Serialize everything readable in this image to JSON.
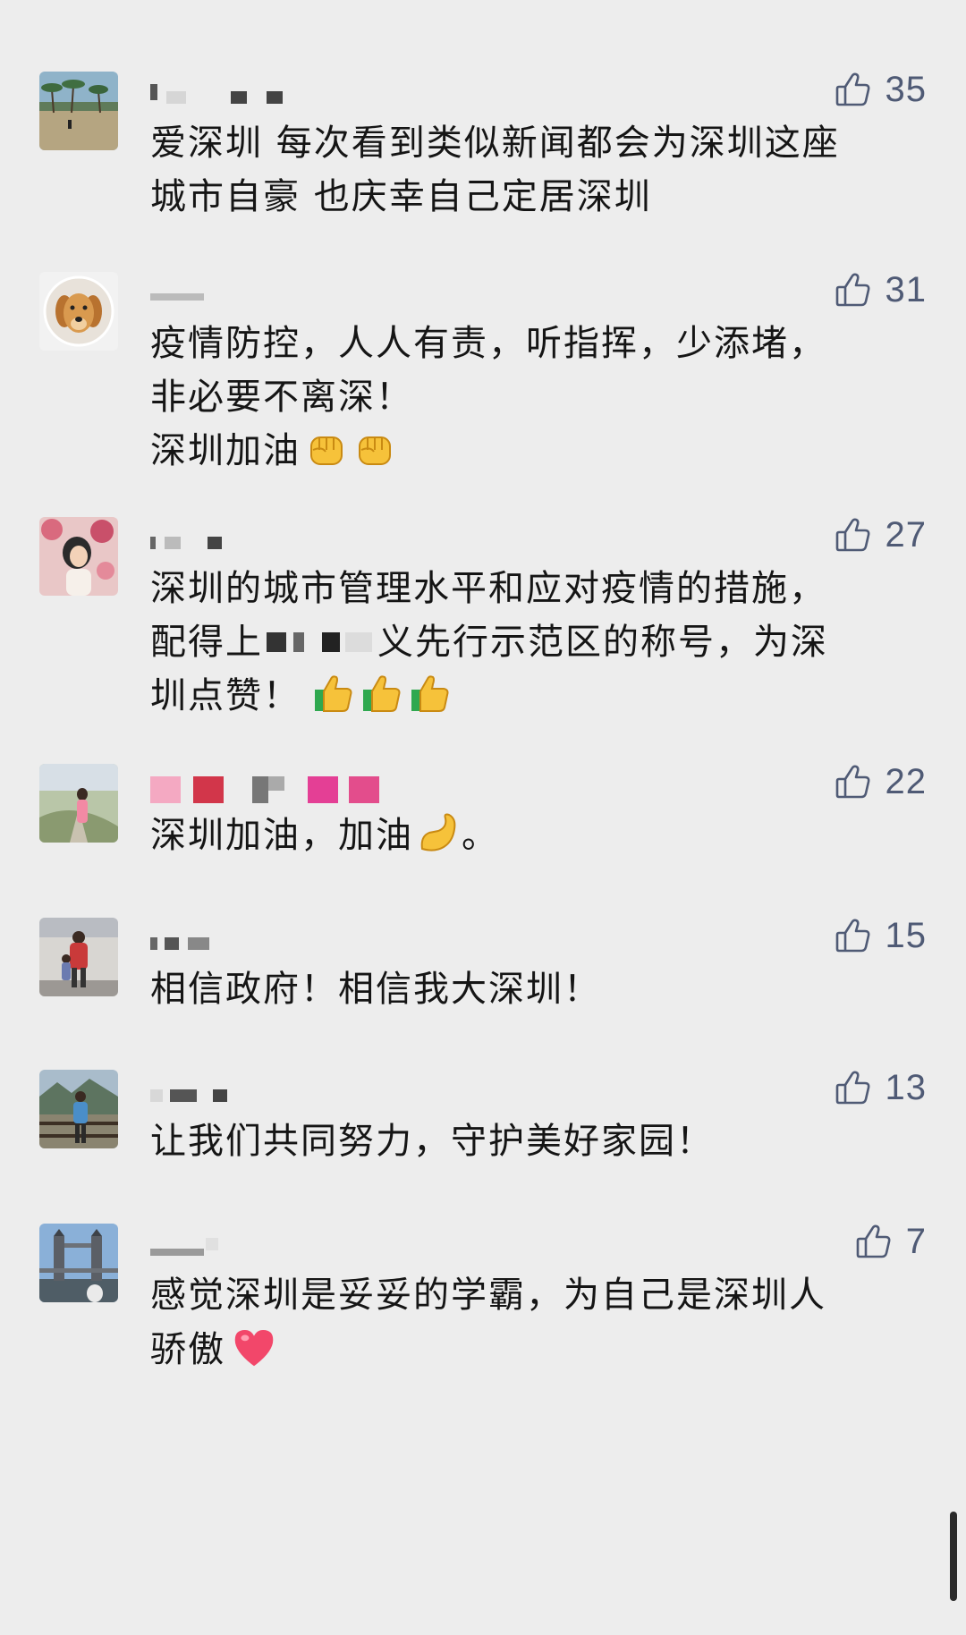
{
  "colors": {
    "background": "#ededed",
    "text": "#151515",
    "like_count": "#4f5a75"
  },
  "comments": [
    {
      "likes": "35",
      "lines": [
        "爱深圳  每次看到类似新闻都会为深圳这座",
        "城市自豪 也庆幸自己定居深圳"
      ],
      "avatar_icon": "beach-photo-avatar",
      "like_icon": "thumbs-up-icon"
    },
    {
      "likes": "31",
      "lines": [
        "疫情防控，人人有责，听指挥，少添堵，",
        "非必要不离深！",
        "深圳加油"
      ],
      "emoji": [
        "raised-fist-emoji",
        "raised-fist-emoji"
      ],
      "avatar_icon": "golden-retriever-avatar",
      "like_icon": "thumbs-up-icon"
    },
    {
      "likes": "27",
      "lines": [
        "深圳的城市管理水平和应对疫情的措施，",
        "配得上",
        "义先行示范区的称号，为深",
        "圳点赞！"
      ],
      "emoji": [
        "thumbs-up-emoji",
        "thumbs-up-emoji",
        "thumbs-up-emoji"
      ],
      "avatar_icon": "girl-flowers-avatar",
      "like_icon": "thumbs-up-icon"
    },
    {
      "likes": "22",
      "lines": [
        "深圳加油，加油",
        "。"
      ],
      "emoji": [
        "flexed-biceps-emoji"
      ],
      "avatar_icon": "woman-path-avatar",
      "like_icon": "thumbs-up-icon"
    },
    {
      "likes": "15",
      "lines": [
        "相信政府！相信我大深圳！"
      ],
      "avatar_icon": "airport-people-avatar",
      "like_icon": "thumbs-up-icon"
    },
    {
      "likes": "13",
      "lines": [
        "让我们共同努力，守护美好家园！"
      ],
      "avatar_icon": "man-railing-avatar",
      "like_icon": "thumbs-up-icon"
    },
    {
      "likes": "7",
      "lines": [
        "感觉深圳是妥妥的学霸，为自己是深圳人",
        "骄傲"
      ],
      "emoji": [
        "red-heart-emoji"
      ],
      "avatar_icon": "tower-bridge-avatar",
      "like_icon": "thumbs-up-icon"
    }
  ]
}
